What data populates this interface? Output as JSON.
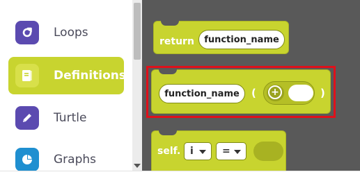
{
  "sidebar": {
    "categories": [
      {
        "label": "Loops",
        "icon": "loop-icon",
        "color": "#5b4ab0"
      },
      {
        "label": "Definitions",
        "icon": "book-icon",
        "color": "#c8d42f",
        "active": true
      },
      {
        "label": "Turtle",
        "icon": "pencil-icon",
        "color": "#5b4ab0"
      },
      {
        "label": "Graphs",
        "icon": "pie-chart-icon",
        "color": "#1f8fd0"
      }
    ]
  },
  "workspace": {
    "return_block": {
      "keyword": "return",
      "value": "function_name"
    },
    "call_block": {
      "name": "function_name",
      "open_paren": "(",
      "close_paren": ")",
      "add_arg": "+"
    },
    "self_block": {
      "keyword": "self.",
      "attr": "i",
      "op": "="
    }
  },
  "colors": {
    "block": "#c8d42f",
    "workspace": "#595959",
    "highlight": "#e0101a"
  }
}
